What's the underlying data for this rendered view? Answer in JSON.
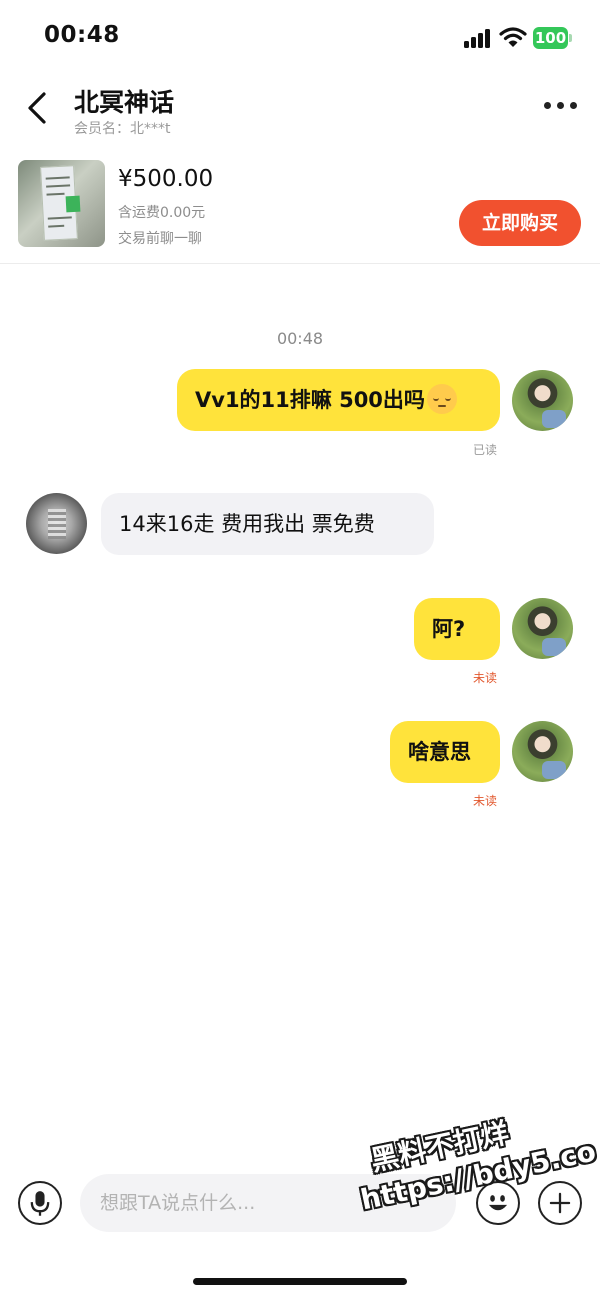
{
  "status_bar": {
    "time": "00:48",
    "battery": "100",
    "battery_color": "#34c759"
  },
  "header": {
    "title": "北冥神话",
    "subtitle": "会员名：北***t"
  },
  "product": {
    "price": "¥500.00",
    "shipping": "含运费0.00元",
    "note": "交易前聊一聊",
    "buy_label": "立即购买",
    "buy_color": "#f1512f"
  },
  "chat": {
    "timestamp": "00:48",
    "messages": [
      {
        "from": "self",
        "text": "Vv1的11排嘛  500出吗",
        "emoji": "relieved-face",
        "status": "已读"
      },
      {
        "from": "other",
        "text": "14来16走 费用我出 票免费"
      },
      {
        "from": "self",
        "text": "阿?",
        "status": "未读"
      },
      {
        "from": "self",
        "text": "啥意思",
        "status": "未读"
      }
    ],
    "self_bubble_color": "#ffe33b",
    "other_bubble_color": "#f2f2f5",
    "unread_color": "#e2582e"
  },
  "input": {
    "placeholder": "想跟TA说点什么..."
  },
  "watermark": {
    "line1": "黑料不打烊",
    "line2": "https://bdy5.co"
  },
  "icons": {
    "back": "chevron-left-icon",
    "more": "more-dots-icon",
    "mic": "microphone-icon",
    "emoji": "emoji-icon",
    "plus": "plus-icon"
  }
}
